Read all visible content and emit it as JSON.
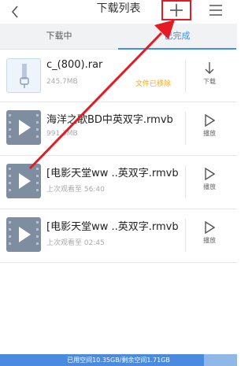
{
  "header": {
    "title": "下载列表",
    "back_icon": "chevron-left-icon",
    "add_icon": "plus-icon",
    "menu_icon": "hamburger-menu-icon"
  },
  "tabs": [
    {
      "label": "下载中",
      "active": false
    },
    {
      "label": "已完成",
      "active": true
    }
  ],
  "items": [
    {
      "name": "c_(800).rar",
      "meta": "245.7MB",
      "status": "文件已移除",
      "action_label": "下载",
      "action_icon": "download-icon",
      "thumb": "file-icon"
    },
    {
      "name": "海洋之歌BD中英双字.rmvb",
      "meta": "991.3MB",
      "action_label": "播放",
      "action_icon": "play-icon",
      "thumb": "video-icon"
    },
    {
      "name": "[电影天堂ww ..英双字.rmvb",
      "meta": "上次观看至 56:40",
      "action_label": "播放",
      "action_icon": "play-icon",
      "thumb": "video-icon"
    },
    {
      "name": "[电影天堂ww ..英双字.rmvb",
      "meta": "上次观看至 02:45",
      "action_label": "播放",
      "action_icon": "play-icon",
      "thumb": "video-icon"
    }
  ],
  "storage": {
    "text": "已用空间10.35GB/剩余空间1.71GB",
    "used_fraction": 0.86
  },
  "colors": {
    "accent": "#3d8ff0",
    "highlight": "#e31b23",
    "status": "#f0a91c"
  }
}
